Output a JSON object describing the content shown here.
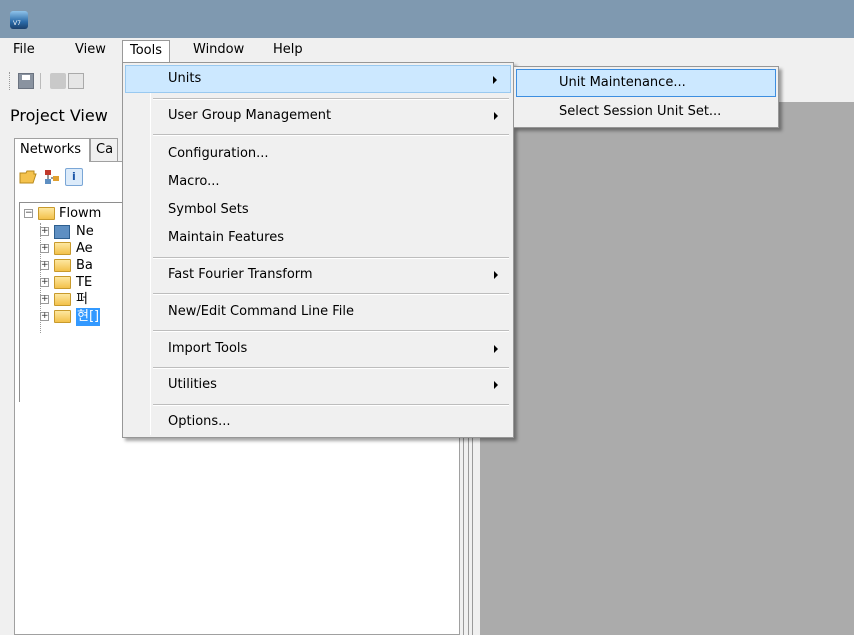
{
  "menubar": {
    "file": "File",
    "view": "View",
    "tools": "Tools",
    "window": "Window",
    "help": "Help"
  },
  "project_view": {
    "title": "Project View"
  },
  "tabs": {
    "networks": "Networks",
    "second": "Ca"
  },
  "tree": {
    "root": "Flowm",
    "items": [
      "Ne",
      "Ae",
      "Ba",
      "TE",
      "퍼"
    ],
    "selected": "현[]"
  },
  "tools_menu": {
    "units": "Units",
    "user_group_management": "User Group Management",
    "configuration": "Configuration...",
    "macro": "Macro...",
    "symbol_sets": "Symbol Sets",
    "maintain_features": "Maintain Features",
    "fft": "Fast Fourier Transform",
    "new_edit_cmd": "New/Edit Command Line File",
    "import_tools": "Import Tools",
    "utilities": "Utilities",
    "options": "Options..."
  },
  "units_submenu": {
    "unit_maintenance": "Unit Maintenance...",
    "select_session_unit_set": "Select Session Unit Set..."
  },
  "colors": {
    "titlebar": "#7f99b0",
    "highlight": "#cce8ff",
    "selection": "#3399ff",
    "workspace": "#ababab"
  }
}
